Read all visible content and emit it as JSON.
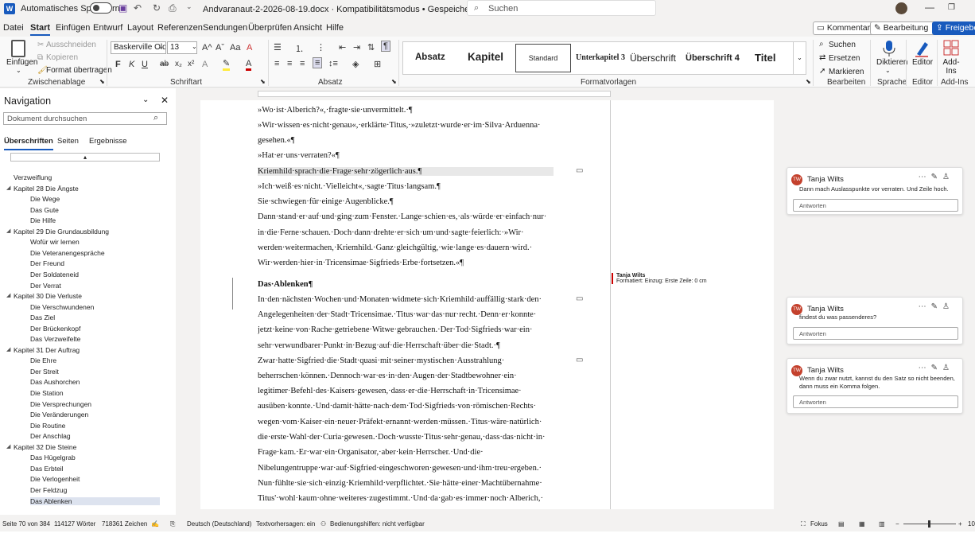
{
  "titlebar": {
    "app_icon": "word-icon",
    "autosave_label": "Automatisches Speichern",
    "doc_title": "Andvaranaut-2-2026-08-19.docx  ·  Kompatibilitätsmodus  •  Gespeichert ⌄",
    "search_placeholder": "Suchen"
  },
  "menu": [
    "Datei",
    "Start",
    "Einfügen",
    "Entwurf",
    "Layout",
    "Referenzen",
    "Sendungen",
    "Überprüfen",
    "Ansicht",
    "Hilfe"
  ],
  "top_buttons": {
    "comments": "Kommentare",
    "editing": "Bearbeitung ⌄",
    "share": "Freigeben"
  },
  "ribbon": {
    "clipboard": {
      "paste": "Einfügen",
      "cut": "Ausschneiden",
      "copy": "Kopieren",
      "format_painter": "Format übertragen",
      "label": "Zwischenablage"
    },
    "font": {
      "name": "Baskerville Old Fa",
      "size": "13",
      "label": "Schriftart",
      "bold": "F",
      "italic": "K",
      "underline": "U",
      "strike": "ab",
      "sub": "x₂",
      "sup": "x²",
      "grow": "A^",
      "shrink": "Aˇ",
      "case": "Aa",
      "clear": "A"
    },
    "paragraph": {
      "label": "Absatz"
    },
    "styles": {
      "items": [
        "Absatz",
        "Kapitel",
        "Standard",
        "Unterkapitel 3",
        "Überschrift",
        "Überschrift 4",
        "Titel"
      ],
      "label": "Formatvorlagen"
    },
    "editing": {
      "find": "Suchen",
      "replace": "Ersetzen",
      "select": "Markieren",
      "label": "Bearbeiten"
    },
    "voice": {
      "dictate": "Diktieren",
      "label": "Sprache"
    },
    "editor": {
      "btn": "Editor",
      "label": "Editor"
    },
    "addins": {
      "btn": "Add-Ins",
      "label": "Add-Ins"
    }
  },
  "nav": {
    "title": "Navigation",
    "search_placeholder": "Dokument durchsuchen",
    "tabs": [
      "Überschriften",
      "Seiten",
      "Ergebnisse"
    ],
    "items": [
      {
        "text": "Verzweiflung",
        "level": 1
      },
      {
        "text": "Kapitel 28 Die Ängste",
        "level": 0
      },
      {
        "text": "Die Wege",
        "level": 1
      },
      {
        "text": "Das Gute",
        "level": 1
      },
      {
        "text": "Die Hilfe",
        "level": 1
      },
      {
        "text": "Kapitel 29 Die Grundausbildung",
        "level": 0
      },
      {
        "text": "Wofür wir lernen",
        "level": 1
      },
      {
        "text": "Die Veteranengespräche",
        "level": 1
      },
      {
        "text": "Der Freund",
        "level": 1
      },
      {
        "text": "Der Soldateneid",
        "level": 1
      },
      {
        "text": "Der Verrat",
        "level": 1
      },
      {
        "text": "Kapitel 30 Die Verluste",
        "level": 0
      },
      {
        "text": "Die Verschwundenen",
        "level": 1
      },
      {
        "text": "Das Ziel",
        "level": 1
      },
      {
        "text": "Der Brückenkopf",
        "level": 1
      },
      {
        "text": "Das Verzweifelte",
        "level": 1
      },
      {
        "text": "Kapitel 31 Der Auftrag",
        "level": 0
      },
      {
        "text": "Die Ehre",
        "level": 1
      },
      {
        "text": "Der Streit",
        "level": 1
      },
      {
        "text": "Das Aushorchen",
        "level": 1
      },
      {
        "text": "Die Station",
        "level": 1
      },
      {
        "text": "Die Versprechungen",
        "level": 1
      },
      {
        "text": "Die Veränderungen",
        "level": 1
      },
      {
        "text": "Die Routine",
        "level": 1
      },
      {
        "text": "Der Anschlag",
        "level": 1
      },
      {
        "text": "Kapitel 32 Die Steine",
        "level": 0
      },
      {
        "text": "Das Hügelgrab",
        "level": 1
      },
      {
        "text": "Das Erbteil",
        "level": 1
      },
      {
        "text": "Die Verlogenheit",
        "level": 1
      },
      {
        "text": "Der Feldzug",
        "level": 1
      },
      {
        "text": "Das Ablenken",
        "level": 1,
        "selected": true
      }
    ]
  },
  "document": {
    "lines": [
      "»Wo·ist·Alberich?«,·fragte·sie·unvermittelt.·¶",
      "»Wir·wissen·es·nicht·genau«,·erklärte·Titus,·»zuletzt·wurde·er·im·Silva·Arduenna·",
      "gesehen.«¶",
      "»Hat·er·uns·verraten?«¶",
      "Kriemhild·sprach·die·Frage·sehr·zögerlich·aus.¶",
      "»Ich·weiß·es·nicht.·Vielleicht«,·sagte·Titus·langsam.¶",
      "Sie·schwiegen·für·einige·Augenblicke.¶",
      "Dann·stand·er·auf·und·ging·zum·Fenster.·Lange·schien·es,·als·würde·er·einfach·nur·",
      "in·die·Ferne·schauen.·Doch·dann·drehte·er·sich·um·und·sagte·feierlich:·»Wir·",
      "werden·weitermachen,·Kriemhild.·Ganz·gleichgültig,·wie·lange·es·dauern·wird.·",
      "Wir·werden·hier·in·Tricensimae·Sigfrieds·Erbe·fortsetzen.«¶",
      "Das·Ablenken¶",
      "In·den·nächsten·Wochen·und·Monaten·widmete·sich·Kriemhild·auffällig·stark·den·",
      "Angelegenheiten·der·Stadt·Tricensimae.·Titus·war·das·nur·recht.·Denn·er·konnte·",
      "jetzt·keine·von·Rache·getriebene·Witwe·gebrauchen.·Der·Tod·Sigfrieds·war·ein·",
      "sehr·verwundbarer·Punkt·in·Bezug·auf·die·Herrschaft·über·die·Stadt.·¶",
      "     Zwar·hatte·Sigfried·die·Stadt·quasi·mit·seiner·mystischen·Ausstrahlung·",
      "beherrschen·können.·Dennoch·war·es·in·den·Augen·der·Stadtbewohner·ein·",
      "legitimer·Befehl·des·Kaisers·gewesen,·dass·er·die·Herrschaft·in·Tricensimae·",
      "ausüben·konnte.·Und·damit·hätte·nach·dem·Tod·Sigfrieds·von·römischen·Rechts·",
      "wegen·vom·Kaiser·ein·neuer·Präfekt·ernannt·werden·müssen.·Titus·wäre·natürlich·",
      "die·erste·Wahl·der·Curia·gewesen.·Doch·wusste·Titus·sehr·genau,·dass·das·nicht·in·",
      "Frage·kam.·Er·war·ein·Organisator,·aber·kein·Herrscher.·Und·die·",
      "Nibelungentruppe·war·auf·Sigfried·eingeschworen·gewesen·und·ihm·treu·ergeben.·",
      "Nun·fühlte·sie·sich·einzig·Kriemhild·verpflichtet.·Sie·hätte·einer·Machtübernahme·",
      "Titus'·wohl·kaum·ohne·weiteres·zugestimmt.·Und·da·gab·es·immer·noch·Alberich,·"
    ]
  },
  "format_note": {
    "author": "Tanja Wilts",
    "text": "Formatiert: Einzug: Erste Zeile:  0 cm"
  },
  "comments": [
    {
      "initials": "TW",
      "author": "Tanja Wilts",
      "text": "Dann mach Auslasspunkte vor verraten. Und Zeile hoch.",
      "reply": "Antworten"
    },
    {
      "initials": "TW",
      "author": "Tanja Wilts",
      "text": "findest du was passenderes?",
      "reply": "Antworten"
    },
    {
      "initials": "TW",
      "author": "Tanja Wilts",
      "text": "Wenn du zwar nutzt, kannst du den Satz so nicht beenden, dann muss ein Komma folgen.",
      "reply": "Antworten"
    }
  ],
  "status": {
    "page": "Seite 70 von 384",
    "words": "114127 Wörter",
    "chars": "718361 Zeichen",
    "language": "Deutsch (Deutschland)",
    "predictions": "Textvorhersagen: ein",
    "accessibility": "Bedienungshilfen: nicht verfügbar",
    "focus": "Fokus",
    "zoom": "10"
  }
}
